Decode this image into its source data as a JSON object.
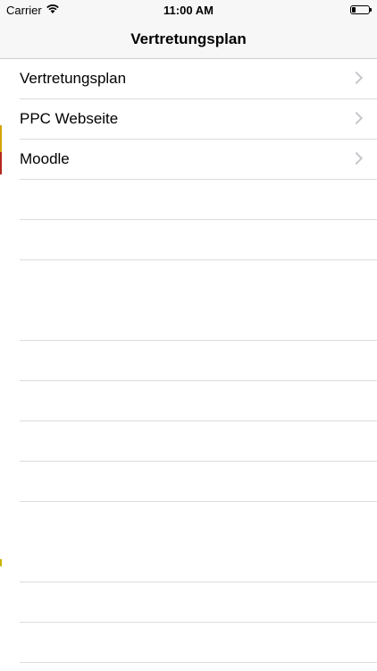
{
  "status_bar": {
    "carrier": "Carrier",
    "time": "11:00 AM"
  },
  "nav": {
    "title": "Vertretungsplan"
  },
  "rows": [
    {
      "label": "Vertretungsplan"
    },
    {
      "label": "PPC Webseite"
    },
    {
      "label": "Moodle"
    }
  ],
  "colors": {
    "chevron": "#c7c7cc",
    "separator": "#dcdcdc",
    "nav_background": "#f7f7f7"
  }
}
